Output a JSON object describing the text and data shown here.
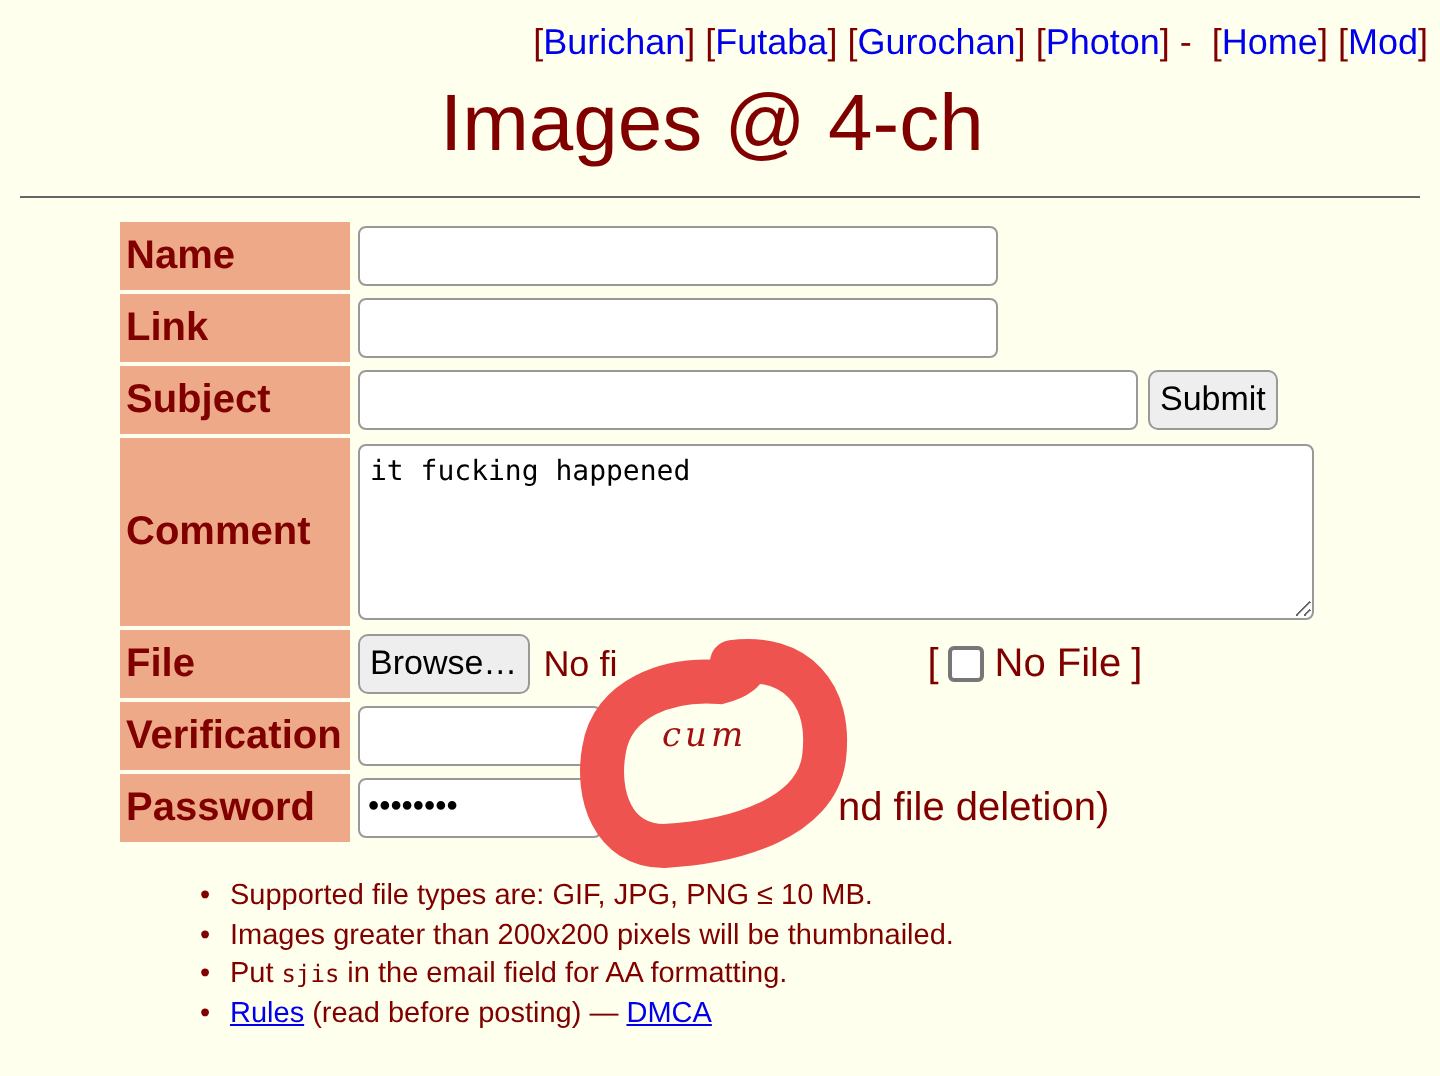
{
  "nav": [
    {
      "kind": "bracket",
      "text": "["
    },
    {
      "kind": "link",
      "text": "Burichan"
    },
    {
      "kind": "bracket",
      "text": "]"
    },
    {
      "kind": "bracket",
      "text": "["
    },
    {
      "kind": "link",
      "text": "Futaba"
    },
    {
      "kind": "bracket",
      "text": "]"
    },
    {
      "kind": "bracket",
      "text": "["
    },
    {
      "kind": "link",
      "text": "Gurochan"
    },
    {
      "kind": "bracket",
      "text": "]"
    },
    {
      "kind": "bracket",
      "text": "["
    },
    {
      "kind": "link",
      "text": "Photon"
    },
    {
      "kind": "bracket",
      "text": "]"
    },
    {
      "kind": "sep",
      "text": "-"
    },
    {
      "kind": "bracket",
      "text": "["
    },
    {
      "kind": "link",
      "text": "Home"
    },
    {
      "kind": "bracket",
      "text": "]"
    },
    {
      "kind": "bracket",
      "text": "["
    },
    {
      "kind": "link",
      "text": "Mod"
    },
    {
      "kind": "bracket",
      "text": "]"
    }
  ],
  "title": "Images @ 4-ch",
  "form": {
    "labels": {
      "name": "Name",
      "link": "Link",
      "subject": "Subject",
      "comment": "Comment",
      "file": "File",
      "verification": "Verification",
      "password": "Password"
    },
    "comment_value": "it fucking happened",
    "submit": "Submit",
    "browse": "Browse…",
    "file_status": "No fi",
    "no_file_open": "[",
    "no_file_label": "No File",
    "no_file_close": "]",
    "no_file_checked": false,
    "captcha": "cum",
    "password_value": "••••••••",
    "password_note": "nd file deletion)"
  },
  "rules": [
    {
      "kind": "text",
      "bullet": "•",
      "text": "Supported file types are: GIF, JPG, PNG ≤ 10 MB."
    },
    {
      "kind": "text",
      "bullet": "•",
      "text": "Images greater than 200x200 pixels will be thumbnailed."
    },
    {
      "kind": "code",
      "bullet": "•",
      "before": "Put",
      "code": "sjis",
      "after": "in the email field for AA formatting."
    },
    {
      "kind": "links",
      "bullet": "•",
      "link1": "Rules",
      "middle": "(read before posting) —",
      "link2": "DMCA"
    }
  ],
  "annotation": {
    "kind": "ring"
  }
}
